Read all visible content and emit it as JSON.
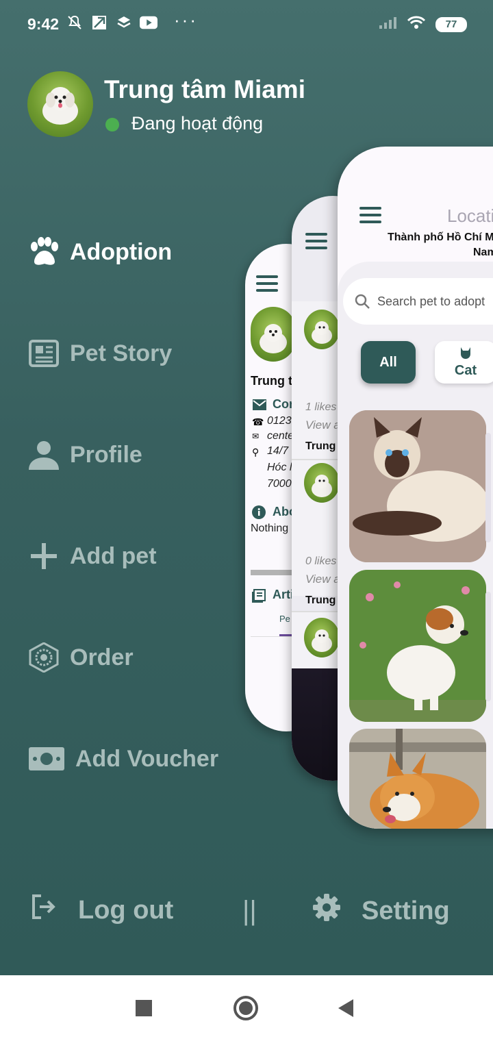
{
  "status_bar": {
    "time": "9:42",
    "dots": "···",
    "battery": "77"
  },
  "profile": {
    "name": "Trung tâm Miami",
    "status": "Đang hoạt động"
  },
  "menu": [
    {
      "label": "Adoption",
      "icon": "paw-icon",
      "active": true
    },
    {
      "label": "Pet Story",
      "icon": "newspaper-icon",
      "active": false
    },
    {
      "label": "Profile",
      "icon": "person-icon",
      "active": false
    },
    {
      "label": "Add pet",
      "icon": "plus-icon",
      "active": false
    },
    {
      "label": "Order",
      "icon": "hexagon-order-icon",
      "active": false
    },
    {
      "label": "Add Voucher",
      "icon": "money-icon",
      "active": false
    }
  ],
  "bottom": {
    "logout": "Log out",
    "separator": "||",
    "setting": "Setting"
  },
  "card_profile": {
    "name": "Trung t",
    "contact_header": "Cor",
    "phone": "0123",
    "email": "cente",
    "address1": "14/7",
    "address2": "Hóc l",
    "address3": "7000",
    "about_header": "Abo",
    "about_text": "Nothing",
    "articles_header": "Arti",
    "tab": "Pe"
  },
  "card_story": {
    "likes1": "1 likes",
    "view1": "View a",
    "author1": "Trung",
    "likes2": "0 likes",
    "view2": "View a",
    "author2": "Trung"
  },
  "card_adoption": {
    "location_label": "Locati",
    "location_value1": "Thành phố Hồ Chí M",
    "location_value2": "Nam",
    "search_placeholder": "Search pet to adopt",
    "filter_all": "All",
    "filter_cat": "Cat"
  },
  "colors": {
    "accent": "#2f5a58",
    "active_dot": "#4caf50"
  }
}
